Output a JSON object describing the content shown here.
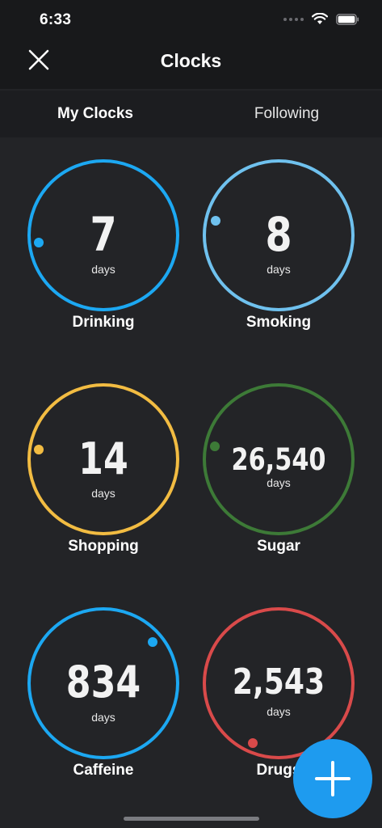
{
  "status": {
    "time": "6:33",
    "icons": [
      "signal-dots-icon",
      "wifi-icon",
      "battery-icon"
    ]
  },
  "nav": {
    "title": "Clocks",
    "close_icon": "close-icon"
  },
  "tabs": [
    {
      "label": "My Clocks",
      "active": true
    },
    {
      "label": "Following",
      "active": false
    }
  ],
  "clocks": [
    {
      "value": "7",
      "unit": "days",
      "label": "Drinking",
      "color": "#1ca8f2"
    },
    {
      "value": "8",
      "unit": "days",
      "label": "Smoking",
      "color": "#6fc1ee"
    },
    {
      "value": "14",
      "unit": "days",
      "label": "Shopping",
      "color": "#f2bc42"
    },
    {
      "value": "26,540",
      "unit": "days",
      "label": "Sugar",
      "color": "#3d7a37"
    },
    {
      "value": "834",
      "unit": "days",
      "label": "Caffeine",
      "color": "#1ca8f2"
    },
    {
      "value": "2,543",
      "unit": "days",
      "label": "Drugs",
      "color": "#d94a4a"
    }
  ],
  "fab": {
    "icon": "plus-icon",
    "color": "#1e9bef"
  }
}
